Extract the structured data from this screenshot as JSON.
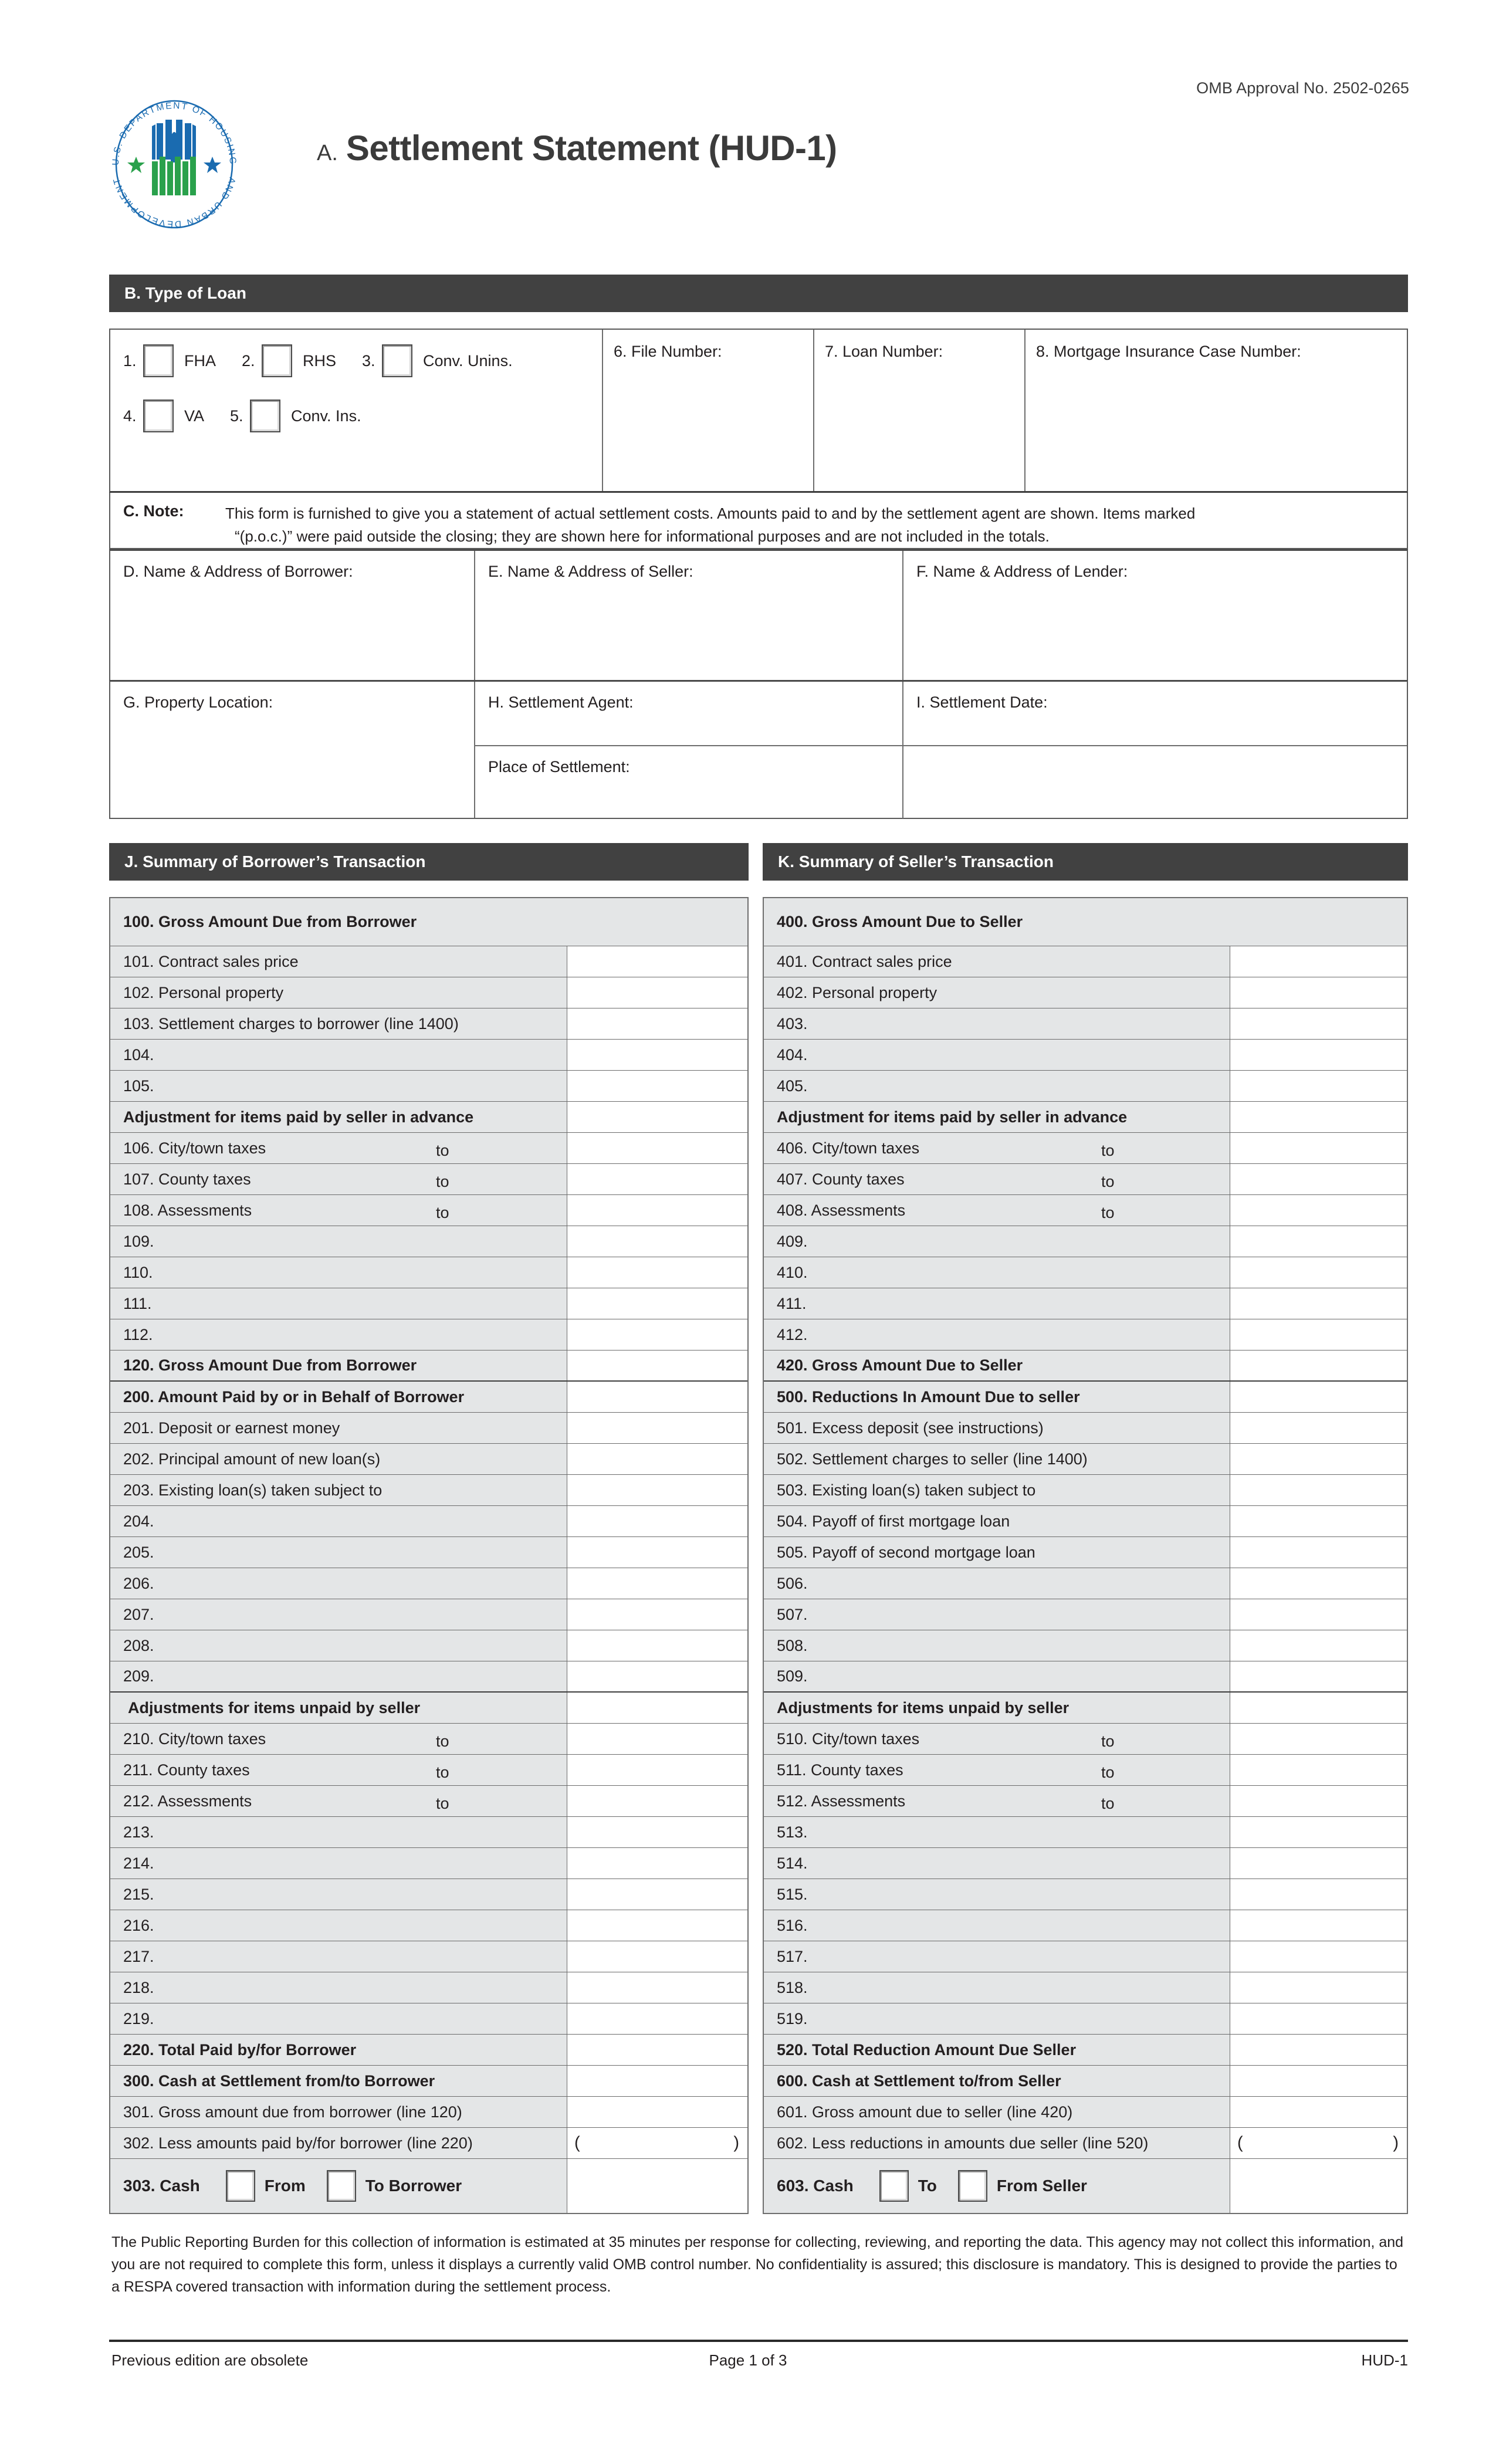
{
  "header": {
    "omb": "OMB Approval No. 2502-0265",
    "title_prefix": "A.",
    "title": "Settlement Statement (HUD-1)",
    "seal_alt": "hud-seal"
  },
  "section_b": {
    "bar_label": "B. Type of Loan",
    "loan_types": [
      {
        "num": "1.",
        "label": "FHA"
      },
      {
        "num": "2.",
        "label": "RHS"
      },
      {
        "num": "3.",
        "label": "Conv. Unins."
      },
      {
        "num": "4.",
        "label": "VA"
      },
      {
        "num": "5.",
        "label": "Conv. Ins."
      }
    ],
    "file_number": "6. File Number:",
    "loan_number": "7. Loan Number:",
    "mic_number": "8. Mortgage Insurance Case Number:"
  },
  "section_c": {
    "label": "C. Note:",
    "line1": "This form is furnished to give you a statement of actual settlement costs. Amounts paid to and by the settlement agent are shown. Items marked",
    "line2": "“(p.o.c.)” were paid outside the closing; they are shown here for informational purposes and are not included in the totals."
  },
  "parties": {
    "borrower": "D. Name & Address of Borrower:",
    "seller": "E. Name & Address of Seller:",
    "lender": "F. Name & Address of Lender:",
    "property_location": "G. Property Location:",
    "settlement_agent": "H. Settlement Agent:",
    "settlement_date": "I. Settlement Date:",
    "place_of_settlement": "Place of Settlement:"
  },
  "borrower_summary": {
    "bar_label": "J. Summary of Borrower’s Transaction",
    "rows": [
      {
        "label": "100. Gross Amount Due from Borrower",
        "bold": true,
        "fullhead": true,
        "tall": true
      },
      {
        "label": "101. Contract sales price"
      },
      {
        "label": "102. Personal property"
      },
      {
        "label": "103. Settlement charges to borrower (line 1400)"
      },
      {
        "label": "104."
      },
      {
        "label": "105."
      },
      {
        "label": "Adjustment for items paid by seller in advance",
        "bold": true
      },
      {
        "label": "106. City/town taxes",
        "to": "to"
      },
      {
        "label": "107. County taxes",
        "to": "to"
      },
      {
        "label": "108. Assessments",
        "to": "to"
      },
      {
        "label": "109."
      },
      {
        "label": "110."
      },
      {
        "label": "111."
      },
      {
        "label": "112."
      },
      {
        "label": "120. Gross Amount Due from Borrower",
        "bold": true,
        "thick": true
      },
      {
        "label": "200. Amount Paid by or in Behalf of Borrower",
        "bold": true
      },
      {
        "label": "201. Deposit or earnest money"
      },
      {
        "label": "202. Principal amount of new loan(s)"
      },
      {
        "label": "203. Existing loan(s) taken subject to"
      },
      {
        "label": "204."
      },
      {
        "label": "205."
      },
      {
        "label": "206."
      },
      {
        "label": "207."
      },
      {
        "label": "208."
      },
      {
        "label": "209.",
        "thick": true
      },
      {
        "label": "Adjustments for items unpaid by seller",
        "bold": true,
        "indent": true
      },
      {
        "label": "210. City/town taxes",
        "to": "to"
      },
      {
        "label": "211. County taxes",
        "to": "to"
      },
      {
        "label": "212. Assessments",
        "to": "to"
      },
      {
        "label": "213."
      },
      {
        "label": "214."
      },
      {
        "label": "215."
      },
      {
        "label": "216."
      },
      {
        "label": "217."
      },
      {
        "label": "218."
      },
      {
        "label": "219."
      },
      {
        "label": "220. Total Paid by/for Borrower",
        "bold": true
      },
      {
        "label": "300. Cash at Settlement from/to Borrower",
        "bold": true
      },
      {
        "label": "301. Gross amount due from borrower (line 120)"
      },
      {
        "label": "302. Less amounts paid by/for borrower (line 220)",
        "paren": true
      }
    ],
    "cash_row": {
      "label": "303. Cash",
      "option1": "From",
      "option2": "To Borrower"
    }
  },
  "seller_summary": {
    "bar_label": "K. Summary of Seller’s Transaction",
    "rows": [
      {
        "label": "400. Gross Amount Due to Seller",
        "bold": true,
        "fullhead": true,
        "tall": true
      },
      {
        "label": "401. Contract sales price"
      },
      {
        "label": "402. Personal property"
      },
      {
        "label": "403."
      },
      {
        "label": "404."
      },
      {
        "label": "405."
      },
      {
        "label": "Adjustment for items paid by seller in advance",
        "bold": true
      },
      {
        "label": "406. City/town taxes",
        "to": "to"
      },
      {
        "label": "407. County taxes",
        "to": "to"
      },
      {
        "label": "408. Assessments",
        "to": "to"
      },
      {
        "label": "409."
      },
      {
        "label": "410."
      },
      {
        "label": "411."
      },
      {
        "label": "412."
      },
      {
        "label": "420. Gross Amount Due to Seller",
        "bold": true,
        "thick": true
      },
      {
        "label": "500. Reductions In Amount Due to seller",
        "bold": true
      },
      {
        "label": "501. Excess deposit (see instructions)"
      },
      {
        "label": "502. Settlement charges to seller (line 1400)"
      },
      {
        "label": "503. Existing loan(s) taken subject to"
      },
      {
        "label": "504. Payoff of first mortgage loan"
      },
      {
        "label": "505. Payoff of second mortgage loan"
      },
      {
        "label": "506."
      },
      {
        "label": "507."
      },
      {
        "label": "508."
      },
      {
        "label": "509.",
        "thick": true
      },
      {
        "label": "Adjustments for items unpaid by seller",
        "bold": true
      },
      {
        "label": "510. City/town taxes",
        "to": "to"
      },
      {
        "label": "511. County taxes",
        "to": "to"
      },
      {
        "label": "512. Assessments",
        "to": "to"
      },
      {
        "label": "513."
      },
      {
        "label": "514."
      },
      {
        "label": "515."
      },
      {
        "label": "516."
      },
      {
        "label": "517."
      },
      {
        "label": "518."
      },
      {
        "label": "519."
      },
      {
        "label": "520. Total Reduction Amount Due Seller",
        "bold": true
      },
      {
        "label": "600. Cash at Settlement to/from Seller",
        "bold": true
      },
      {
        "label": "601. Gross amount due to seller (line 420)"
      },
      {
        "label": "602. Less reductions in amounts due seller (line 520)",
        "paren": true
      }
    ],
    "cash_row": {
      "label": "603. Cash",
      "option1": "To",
      "option2": "From Seller"
    }
  },
  "footer": {
    "burden": "The Public Reporting Burden for this collection of information is estimated at 35 minutes per response for collecting, reviewing, and reporting the data. This agency may not collect this information, and you are not required to complete this form, unless it displays a currently valid OMB control number. No confidentiality is assured; this disclosure is mandatory. This is designed to provide the parties to a RESPA covered transaction with information during the settlement process.",
    "left": "Previous edition are obsolete",
    "center": "Page 1 of 3",
    "right": "HUD-1"
  },
  "colors": {
    "bar": "#414141",
    "row_label_bg": "#e4e6e7",
    "seal_blue": "#1a6bb0",
    "seal_green": "#2aa14c",
    "text": "#231f20"
  }
}
